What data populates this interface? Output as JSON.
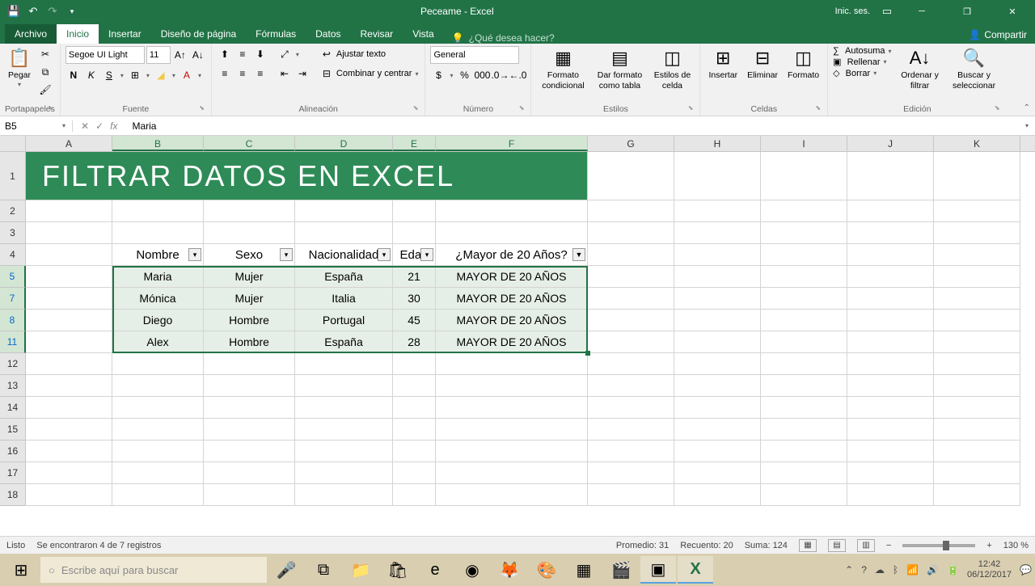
{
  "title": "Peceame - Excel",
  "signin": "Inic. ses.",
  "tabs": {
    "file": "Archivo",
    "home": "Inicio",
    "insert": "Insertar",
    "layout": "Diseño de página",
    "formulas": "Fórmulas",
    "data": "Datos",
    "review": "Revisar",
    "view": "Vista",
    "tellme": "¿Qué desea hacer?",
    "share": "Compartir"
  },
  "ribbon": {
    "paste": "Pegar",
    "clipboard": "Portapapeles",
    "font_name": "Segoe UI Light",
    "font_size": "11",
    "font_group": "Fuente",
    "wrap": "Ajustar texto",
    "merge": "Combinar y centrar",
    "align_group": "Alineación",
    "number_format": "General",
    "number_group": "Número",
    "cond_fmt": "Formato condicional",
    "tbl_fmt": "Dar formato como tabla",
    "cell_styles": "Estilos de celda",
    "styles_group": "Estilos",
    "insert": "Insertar",
    "delete": "Eliminar",
    "format": "Formato",
    "cells_group": "Celdas",
    "autosum": "Autosuma",
    "fill": "Rellenar",
    "clear": "Borrar",
    "sort": "Ordenar y filtrar",
    "find": "Buscar y seleccionar",
    "edit_group": "Edición"
  },
  "namebox": "B5",
  "formula": "Maria",
  "col_letters": [
    "A",
    "B",
    "C",
    "D",
    "E",
    "F",
    "G",
    "H",
    "I",
    "J",
    "K"
  ],
  "big_title": "FILTRAR DATOS EN EXCEL",
  "headers": {
    "b": "Nombre",
    "c": "Sexo",
    "d": "Nacionalidad",
    "e": "Edad",
    "f": "¿Mayor de 20 Años?"
  },
  "rows": [
    {
      "n": "5",
      "b": "Maria",
      "c": "Mujer",
      "d": "España",
      "e": "21",
      "f": "MAYOR DE 20 AÑOS"
    },
    {
      "n": "7",
      "b": "Mónica",
      "c": "Mujer",
      "d": "Italia",
      "e": "30",
      "f": "MAYOR DE 20 AÑOS"
    },
    {
      "n": "8",
      "b": "Diego",
      "c": "Hombre",
      "d": "Portugal",
      "e": "45",
      "f": "MAYOR DE 20 AÑOS"
    },
    {
      "n": "11",
      "b": "Alex",
      "c": "Hombre",
      "d": "España",
      "e": "28",
      "f": "MAYOR DE 20 AÑOS"
    }
  ],
  "empty_rows": [
    "2",
    "3",
    "12",
    "13",
    "14",
    "15",
    "16",
    "17",
    "18"
  ],
  "status": {
    "ready": "Listo",
    "filter_msg": "Se encontraron 4 de 7 registros",
    "avg": "Promedio: 31",
    "count": "Recuento: 20",
    "sum": "Suma: 124",
    "zoom": "130 %"
  },
  "taskbar": {
    "search_ph": "Escribe aquí para buscar",
    "time": "12:42",
    "date": "06/12/2017"
  }
}
